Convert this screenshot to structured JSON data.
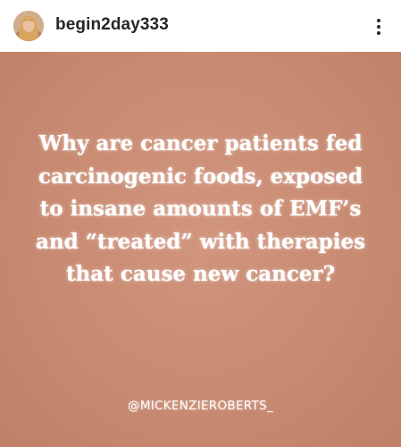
{
  "header": {
    "username": "begin2day333",
    "avatar_icon": "profile-photo-icon",
    "more_icon": "more-options-vertical-icon"
  },
  "post": {
    "background_color": "#c98a72",
    "text_color": "#ffffff",
    "quote_lines": [
      "Why are cancer patients fed",
      "carcinogenic foods, exposed",
      "to insane amounts of EMF’s",
      "and “treated” with therapies",
      "that cause new cancer?"
    ],
    "watermark": "@MICKENZIEROBERTS_"
  }
}
